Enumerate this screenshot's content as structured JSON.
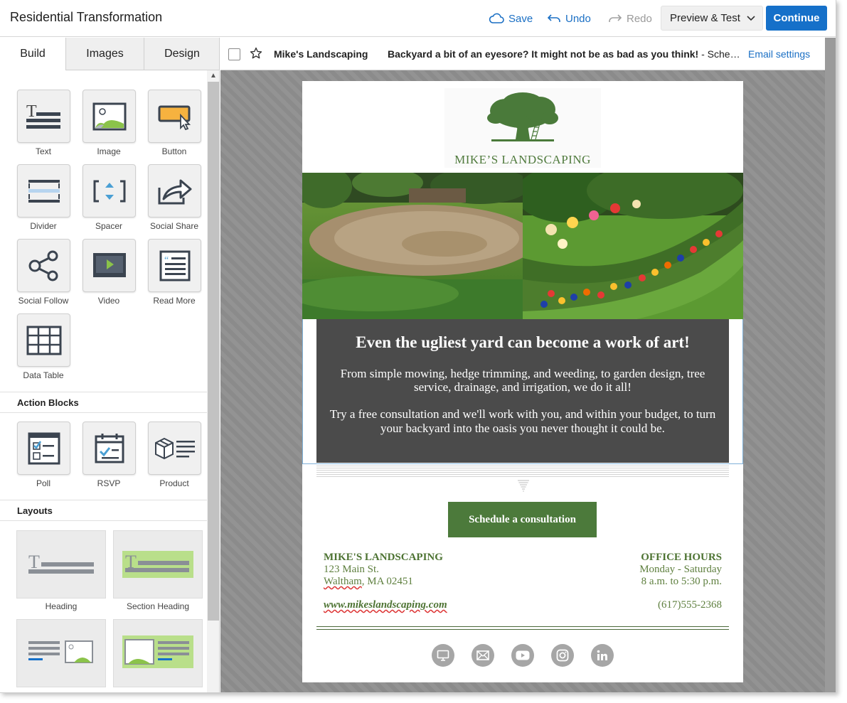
{
  "app": {
    "title": "Residential Transformation"
  },
  "toolbar": {
    "save_label": "Save",
    "undo_label": "Undo",
    "redo_label": "Redo",
    "preview_label": "Preview & Test",
    "continue_label": "Continue",
    "accent_color": "#1570c9"
  },
  "sidebar": {
    "tabs": [
      {
        "label": "Build",
        "active": true
      },
      {
        "label": "Images",
        "active": false
      },
      {
        "label": "Design",
        "active": false
      }
    ],
    "blocks": [
      {
        "label": "Text",
        "icon": "text-icon"
      },
      {
        "label": "Image",
        "icon": "image-icon"
      },
      {
        "label": "Button",
        "icon": "button-icon"
      },
      {
        "label": "Divider",
        "icon": "divider-icon"
      },
      {
        "label": "Spacer",
        "icon": "spacer-icon"
      },
      {
        "label": "Social Share",
        "icon": "social-share-icon"
      },
      {
        "label": "Social Follow",
        "icon": "social-follow-icon"
      },
      {
        "label": "Video",
        "icon": "video-icon"
      },
      {
        "label": "Read More",
        "icon": "read-more-icon"
      },
      {
        "label": "Data Table",
        "icon": "data-table-icon"
      }
    ],
    "action_blocks_heading": "Action Blocks",
    "action_blocks": [
      {
        "label": "Poll",
        "icon": "poll-icon"
      },
      {
        "label": "RSVP",
        "icon": "rsvp-icon"
      },
      {
        "label": "Product",
        "icon": "product-icon"
      }
    ],
    "layouts_heading": "Layouts",
    "layouts": [
      {
        "label": "Heading"
      },
      {
        "label": "Section Heading"
      }
    ]
  },
  "email_header": {
    "from": "Mike's Landscaping",
    "subject_bold": "Backyard a bit of an eyesore? It might not be as bad as you think!",
    "subject_rest": " - Schedule a consultation",
    "settings_link": "Email settings"
  },
  "email": {
    "logo_text": "MIKE’S LANDSCAPING",
    "hero_title": "Even the ugliest yard can become a work of art!",
    "hero_p1": "From simple mowing, hedge trimming, and weeding, to garden design, tree service, drainage, and irrigation, we do it all!",
    "hero_p2": "Try a free consultation and we'll work with you, and within your budget, to turn your backyard into the oasis you never thought it could be.",
    "cta_label": "Schedule a consultation",
    "footer": {
      "company": "MIKE'S LANDSCAPING",
      "address_line1": "123 Main St.",
      "address_city": "Waltham",
      "address_rest": ", MA 02451",
      "hours_heading": "OFFICE HOURS",
      "hours_days": "Monday - Saturday",
      "hours_time": "8 a.m. to 5:30 p.m.",
      "website": "www.mikeslandscaping.com",
      "phone": "(617)555-2368"
    },
    "social_icons": [
      "website-icon",
      "email-icon",
      "youtube-icon",
      "instagram-icon",
      "linkedin-icon"
    ],
    "brand_green": "#4c7a3b",
    "hero_bg": "#4b4b4b"
  }
}
